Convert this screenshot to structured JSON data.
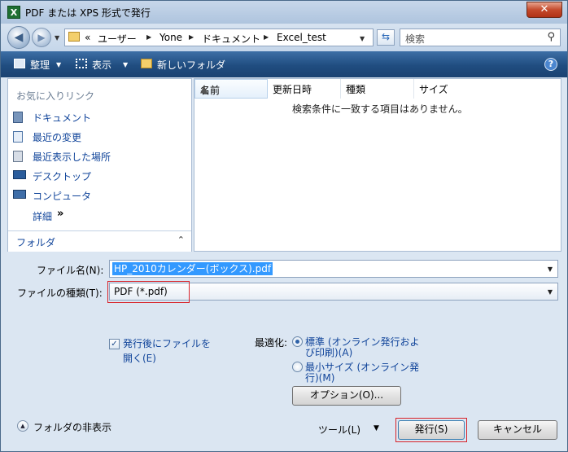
{
  "window": {
    "title": "PDF または XPS 形式で発行",
    "app_icon": "X",
    "close_glyph": "✕"
  },
  "address": {
    "prefix": "«",
    "crumbs": [
      "ユーザー",
      "Yone",
      "ドキュメント",
      "Excel_test"
    ],
    "search_placeholder": "検索"
  },
  "toolbar": {
    "organize": "整理",
    "view": "表示",
    "new_folder": "新しいフォルダ",
    "help": "?"
  },
  "sidebar": {
    "heading": "お気に入りリンク",
    "items": [
      {
        "label": "ドキュメント",
        "icon": "documents-icon"
      },
      {
        "label": "最近の変更",
        "icon": "recent-changes-icon"
      },
      {
        "label": "最近表示した場所",
        "icon": "recent-places-icon"
      },
      {
        "label": "デスクトップ",
        "icon": "desktop-icon"
      },
      {
        "label": "コンピュータ",
        "icon": "computer-icon"
      }
    ],
    "more": "詳細",
    "more_glyph": "»",
    "folders": "フォルダ"
  },
  "filelist": {
    "columns": [
      "名前",
      "更新日時",
      "種類",
      "サイズ"
    ],
    "empty_message": "検索条件に一致する項目はありません。"
  },
  "form": {
    "filename_label": "ファイル名(N):",
    "filename_value": "HP_2010カレンダー(ボックス).pdf",
    "filetype_label": "ファイルの種類(T):",
    "filetype_value": "PDF (*.pdf)",
    "open_after_line1": "発行後にファイルを",
    "open_after_line2": "開く(E)",
    "optimize_label": "最適化:",
    "standard_line1": "標準 (オンライン発行およ",
    "standard_line2": "び印刷)(A)",
    "minimum_line1": "最小サイズ (オンライン発",
    "minimum_line2": "行)(M)",
    "options_button": "オプション(O)...",
    "hide_folders": "フォルダの非表示",
    "tools": "ツール(L)",
    "publish_button": "発行(S)",
    "cancel_button": "キャンセル"
  },
  "colors": {
    "highlight": "#d8232a",
    "toolbar": "#204d80",
    "link": "#10449a",
    "selection": "#3399ff"
  }
}
